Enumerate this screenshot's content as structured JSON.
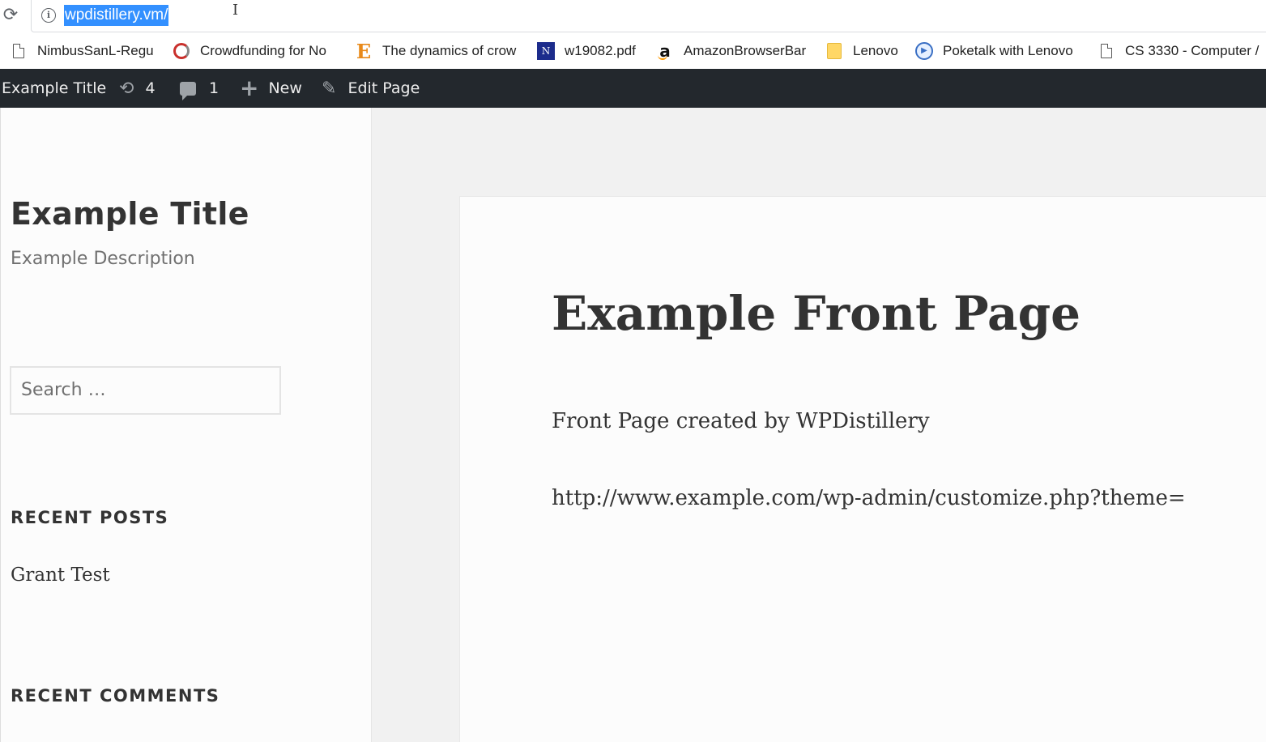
{
  "browser": {
    "url": "wpdistillery.vm/",
    "bookmarks": [
      {
        "label": "NimbusSanL-Regu",
        "icon": "document-icon"
      },
      {
        "label": "Crowdfunding for No",
        "icon": "crowdfunding-icon"
      },
      {
        "label": "The dynamics of crow",
        "icon": "e-letter-icon"
      },
      {
        "label": "w19082.pdf",
        "icon": "nber-icon"
      },
      {
        "label": "AmazonBrowserBar",
        "icon": "amazon-icon"
      },
      {
        "label": "Lenovo",
        "icon": "folder-icon"
      },
      {
        "label": "Poketalk with Lenovo",
        "icon": "play-icon"
      },
      {
        "label": "CS 3330 - Computer /",
        "icon": "document-icon"
      }
    ]
  },
  "adminbar": {
    "site_name": "Example Title",
    "updates_count": "4",
    "comments_count": "1",
    "new_label": "New",
    "edit_label": "Edit Page"
  },
  "sidebar": {
    "site_title": "Example Title",
    "site_description": "Example Description",
    "search_placeholder": "Search …",
    "recent_posts_heading": "RECENT POSTS",
    "recent_posts": [
      "Grant Test"
    ],
    "recent_comments_heading": "RECENT COMMENTS"
  },
  "main": {
    "title": "Example Front Page",
    "paragraphs": [
      "Front Page created by WPDistillery",
      "http://www.example.com/wp-admin/customize.php?theme="
    ]
  }
}
